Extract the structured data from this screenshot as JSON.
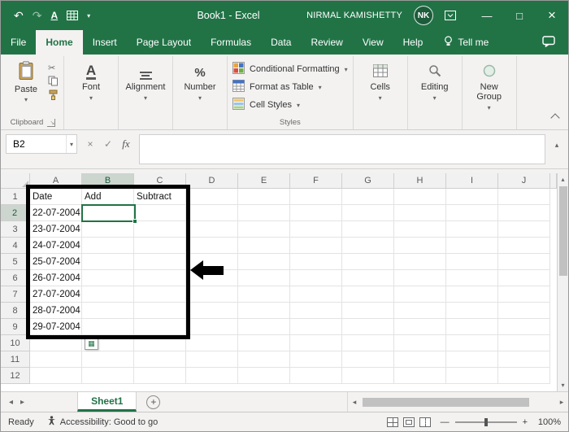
{
  "titlebar": {
    "title": "Book1 - Excel",
    "user_name": "NIRMAL KAMISHETTY",
    "user_initials": "NK"
  },
  "ribbon_tabs": [
    {
      "label": "File"
    },
    {
      "label": "Home"
    },
    {
      "label": "Insert"
    },
    {
      "label": "Page Layout"
    },
    {
      "label": "Formulas"
    },
    {
      "label": "Data"
    },
    {
      "label": "Review"
    },
    {
      "label": "View"
    },
    {
      "label": "Help"
    }
  ],
  "tell_me_label": "Tell me",
  "ribbon": {
    "paste_label": "Paste",
    "groups": {
      "clipboard": "Clipboard",
      "font": "Font",
      "alignment": "Alignment",
      "number": "Number",
      "styles": "Styles",
      "cells": "Cells",
      "editing": "Editing",
      "new_group": "New Group"
    },
    "styles_buttons": {
      "conditional_formatting": "Conditional Formatting",
      "format_as_table": "Format as Table",
      "cell_styles": "Cell Styles"
    }
  },
  "formula_bar": {
    "name_box_value": "B2",
    "fx_label": "fx",
    "formula_value": ""
  },
  "grid": {
    "columns": [
      "A",
      "B",
      "C",
      "D",
      "E",
      "F",
      "G",
      "H",
      "I",
      "J"
    ],
    "row_count": 12,
    "selection": {
      "cell": "B2",
      "column": "B",
      "row": 2
    },
    "cells": {
      "A1": "Date",
      "B1": "Add",
      "C1": "Subtract",
      "A2": "22-07-2004",
      "A3": "23-07-2004",
      "A4": "24-07-2004",
      "A5": "25-07-2004",
      "A6": "26-07-2004",
      "A7": "27-07-2004",
      "A8": "28-07-2004",
      "A9": "29-07-2004"
    }
  },
  "sheet_bar": {
    "sheet_name": "Sheet1"
  },
  "status_bar": {
    "ready_label": "Ready",
    "accessibility_label": "Accessibility: Good to go",
    "zoom_level": "100%"
  },
  "icons": {
    "undo": "↶",
    "redo": "↷",
    "qat_font": "A",
    "caret_down": "▾",
    "minimize": "—",
    "maximize": "□",
    "close": "×",
    "cut": "✂",
    "check": "✓",
    "cancel": "×",
    "percent": "%",
    "collapse_up": "▴",
    "scroll_up": "▴",
    "scroll_down": "▾",
    "scroll_left": "◂",
    "scroll_right": "▸",
    "add_sheet": "+",
    "zoom_out": "—",
    "zoom_in": "+",
    "autofill_grid": "▦",
    "launcher": "↘"
  },
  "colors": {
    "excel_green": "#217346"
  }
}
